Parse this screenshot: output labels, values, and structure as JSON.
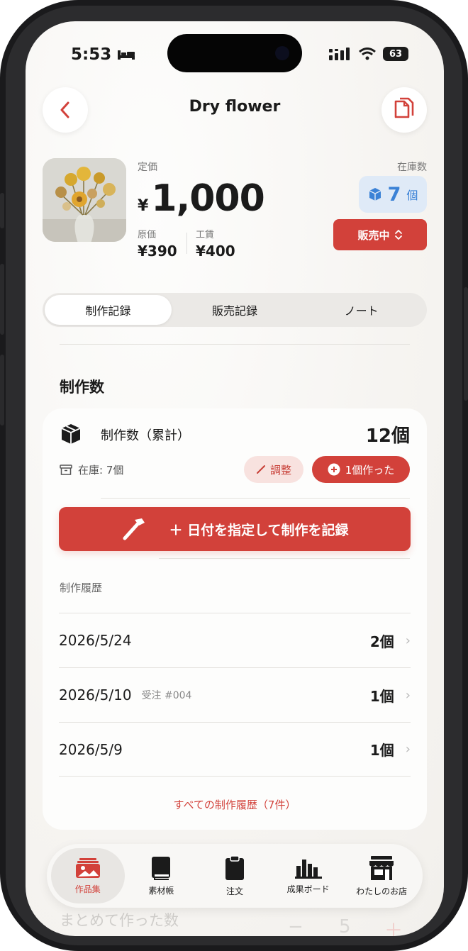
{
  "status_bar": {
    "time": "5:53",
    "battery": "63"
  },
  "header": {
    "title": "Dry flower"
  },
  "product": {
    "list_price_label": "定価",
    "currency": "¥",
    "list_price": "1,000",
    "cost_label": "原価",
    "cost_value": "¥390",
    "labor_label": "工賃",
    "labor_value": "¥400",
    "stock_label": "在庫数",
    "stock_count": "7",
    "stock_unit": "個",
    "sale_status": "販売中"
  },
  "segments": [
    "制作記録",
    "販売記録",
    "ノート"
  ],
  "production": {
    "section_title": "制作数",
    "cumulative_label": "制作数（累計）",
    "cumulative_value": "12個",
    "stock_text": "在庫: 7個",
    "adjust_label": "調整",
    "made_one_label": "1個作った",
    "record_button_label": "＋ 日付を指定して制作を記録",
    "history_title": "制作履歴",
    "history": [
      {
        "date": "2026/5/24",
        "order": "",
        "qty": "2個"
      },
      {
        "date": "2026/5/10",
        "order": "受注 #004",
        "qty": "1個"
      },
      {
        "date": "2026/5/9",
        "order": "",
        "qty": "1個"
      }
    ],
    "see_all_label": "すべての制作履歴（7件）"
  },
  "background_peek": {
    "text": "まとめて作った数",
    "minus": "−",
    "value": "5",
    "plus": "＋"
  },
  "tabbar": {
    "items": [
      {
        "label": "作品集",
        "icon": "photo-gallery-icon"
      },
      {
        "label": "素材帳",
        "icon": "book-icon"
      },
      {
        "label": "注文",
        "icon": "clipboard-icon"
      },
      {
        "label": "成果ボード",
        "icon": "bar-chart-icon"
      },
      {
        "label": "わたしのお店",
        "icon": "storefront-icon"
      }
    ]
  },
  "colors": {
    "accent": "#d2413a",
    "stock_blue": "#3b82d6",
    "stock_bg": "#dfeaf7"
  }
}
